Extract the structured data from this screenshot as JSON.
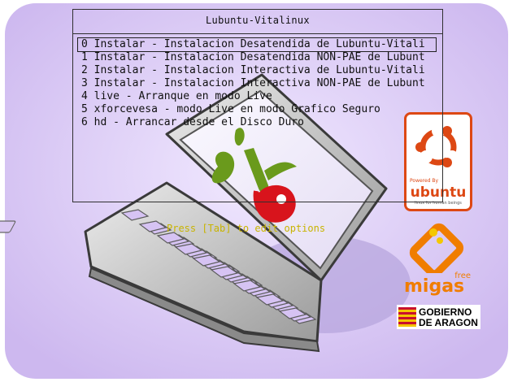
{
  "boot": {
    "title": "Lubuntu-Vitalinux",
    "selected_index": 0,
    "items": [
      {
        "label": "0 Instalar - Instalacion Desatendida de Lubuntu-Vitali"
      },
      {
        "label": "1 Instalar - Instalacion Desatendida NON-PAE de Lubunt"
      },
      {
        "label": "2 Instalar - Instalacion Interactiva de Lubuntu-Vitali"
      },
      {
        "label": "3 Instalar - Instalacion Interactiva NON-PAE de Lubunt"
      },
      {
        "label": "4 live - Arranque en modo Live"
      },
      {
        "label": "5 xforcevesa - modo Live en modo Grafico Seguro"
      },
      {
        "label": "6 hd - Arrancar desde el Disco Duro"
      }
    ],
    "hint": "Press [Tab] to edit options"
  },
  "logos": {
    "ubuntu_powered": "Powered By",
    "ubuntu_name": "ubuntu",
    "ubuntu_tagline": "linux for human beings",
    "migas_free": "free",
    "migas_name": "migas",
    "gobierno_line1": "GOBIERNO",
    "gobierno_line2": "DE ARAGON"
  },
  "colors": {
    "background": "#dccbf5",
    "ubuntu_orange": "#dd4814",
    "migas_orange": "#f07d00",
    "hint_yellow": "#c8b400",
    "live_green": "#6a9a1c",
    "live_red": "#d8141c"
  }
}
